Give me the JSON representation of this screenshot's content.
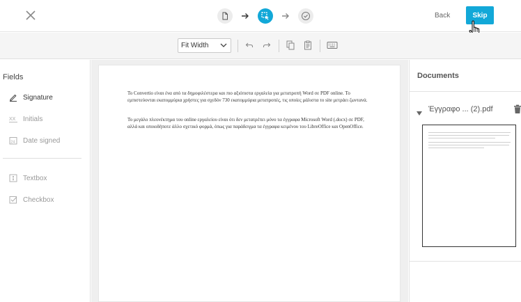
{
  "topbar": {
    "back_label": "Back",
    "skip_label": "Skip",
    "steps": [
      {
        "icon": "document-icon",
        "state": "done"
      },
      {
        "icon": "select-fields-icon",
        "state": "active"
      },
      {
        "icon": "check-circle-icon",
        "state": "pending"
      }
    ],
    "accent_color": "#12a8d8"
  },
  "toolbar": {
    "zoom_value": "Fit Width",
    "buttons": [
      "undo-icon",
      "redo-icon",
      "copy-icon",
      "clipboard-icon",
      "keyboard-icon"
    ]
  },
  "left_panel": {
    "title": "Fields",
    "items": [
      {
        "label": "Signature",
        "icon": "pen-icon"
      },
      {
        "label": "Initials",
        "icon": "initials-icon"
      },
      {
        "label": "Date signed",
        "icon": "calendar-icon"
      },
      {
        "label": "Textbox",
        "icon": "textbox-icon"
      },
      {
        "label": "Checkbox",
        "icon": "checkbox-icon"
      }
    ]
  },
  "document": {
    "paragraph1": "Το Convertio είναι ένα από τα δημοφιλέστερα και πιο αξιόπιστα εργαλεία για μετατροπή Word σε PDF online. Το εμπιστεύονται εκατομμύρια χρήστες για σχεδόν 730 εκατομμύρια μετατροπές, τις οποίες μάλιστα το site μετράει ζωντανά.",
    "paragraph2": "Το μεγάλο πλεονέκτημα του online εργαλείου είναι ότι δεν μετατρέπει μόνο τα έγγραφα Microsoft Word (.docx) σε PDF, αλλά και οποιοδήποτε άλλο σχετικό φορμά, όπως για παράδειγμα τα έγγραφα κειμένου του LibreOffice και OpenOffice."
  },
  "right_panel": {
    "title": "Documents",
    "file_name": "Έγγραφο ... (2).pdf"
  }
}
